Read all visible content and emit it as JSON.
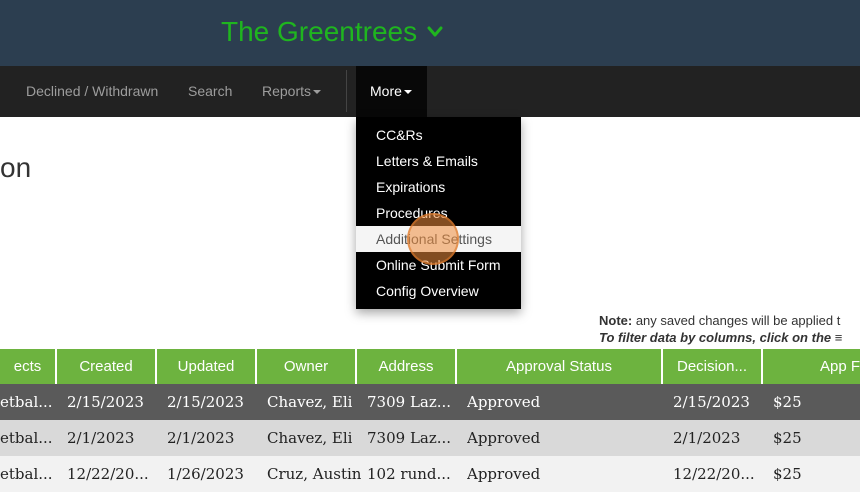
{
  "header": {
    "title": "The Greentrees"
  },
  "nav": {
    "items": [
      "Declined / Withdrawn",
      "Search",
      "Reports"
    ],
    "more_label": "More"
  },
  "page": {
    "title_fragment": "on"
  },
  "dropdown": {
    "items": [
      "CC&Rs",
      "Letters & Emails",
      "Expirations",
      "Procedures",
      "Additional Settings",
      "Online Submit Form",
      "Config Overview"
    ],
    "active_index": 4
  },
  "notes": {
    "note_label": "Note:",
    "note_text": " any saved changes will be applied t",
    "filter_hint": "To filter data by columns, click on the ≡"
  },
  "table": {
    "headers": [
      "ects",
      "Created",
      "Updated",
      "Owner",
      "Address",
      "Approval Status",
      "Decision...",
      "App F"
    ],
    "rows": [
      [
        "etbal...",
        "2/15/2023",
        "2/15/2023",
        "Chavez, Eli",
        "7309 Laz...",
        "Approved",
        "2/15/2023",
        "$25"
      ],
      [
        "etbal...",
        "2/1/2023",
        "2/1/2023",
        "Chavez, Eli",
        "7309 Laz...",
        "Approved",
        "2/1/2023",
        "$25"
      ],
      [
        "etbal...",
        "12/22/20...",
        "1/26/2023",
        "Cruz, Austin",
        "102 rund...",
        "Approved",
        "12/22/20...",
        "$25"
      ]
    ]
  },
  "colors": {
    "header_bg": "#2c3e50",
    "title_green": "#1fb51f",
    "nav_bg": "#222222",
    "table_header": "#6db33f"
  }
}
